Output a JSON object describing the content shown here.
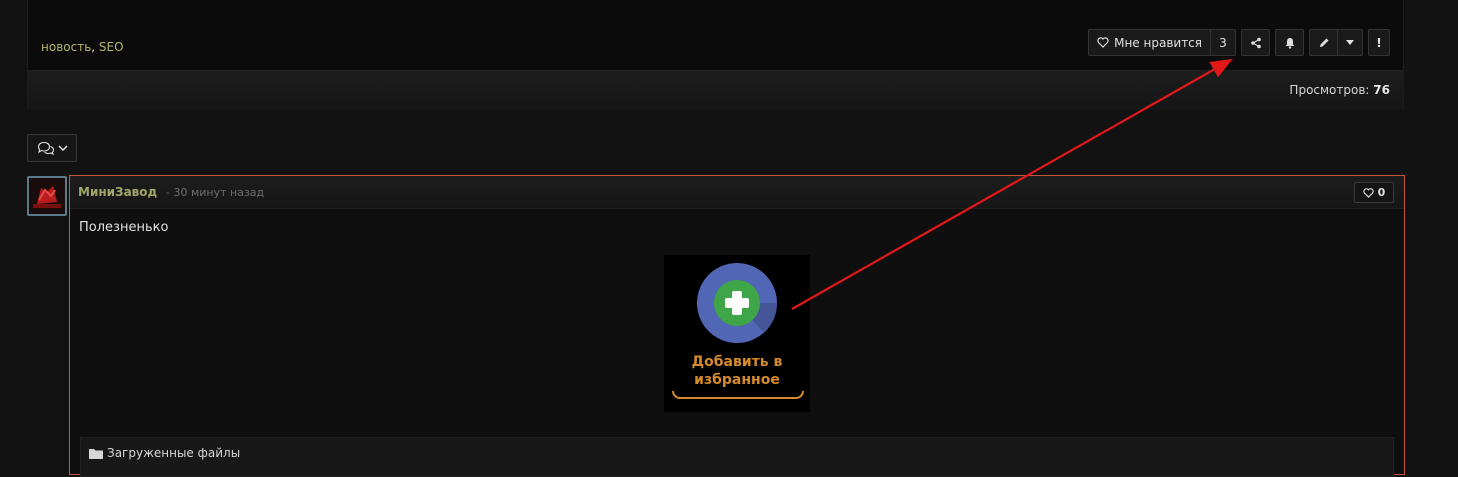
{
  "post": {
    "tags": [
      "новость",
      "SEO"
    ],
    "tag_separator": ",",
    "actions": {
      "like_label": "Мне нравится",
      "like_count": "3",
      "share_icon": "share-icon",
      "follow_icon": "bell-icon",
      "edit_icon": "pencil-icon",
      "edit_menu_icon": "caret-down-icon",
      "report_label": "!"
    },
    "views_label": "Просмотров:",
    "views_count": "76"
  },
  "comments_toggle": {
    "icon": "comments-icon",
    "chevron": "chevron-down-icon"
  },
  "comment": {
    "author": "МиниЗавод",
    "time": "- 30 минут назад",
    "like_count": "0",
    "text": "Полезненько",
    "image": {
      "label_line1": "Добавить в",
      "label_line2": "избранное",
      "icon": "add-favorite-icon"
    },
    "attachments_title": "Загруженные файлы"
  },
  "colors": {
    "accent": "#c2563f",
    "tag": "#b9b46a",
    "author": "#a1a66a",
    "favorite_label": "#d58b2a",
    "arrow": "#e01818"
  }
}
